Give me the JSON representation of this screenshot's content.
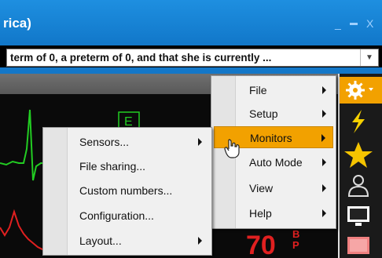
{
  "window": {
    "title": "rica)",
    "min_glyph": "_",
    "max_glyph": "▬",
    "close_glyph": "X"
  },
  "prompt": {
    "text": "term of 0, a preterm of 0, and that she is currently ..."
  },
  "monitor": {
    "lead_label": "E",
    "numeric_value": "70",
    "numeric_label_1": "B",
    "numeric_label_2": "P"
  },
  "main_menu": {
    "items": [
      {
        "label": "File",
        "submenu": true
      },
      {
        "label": "Setup",
        "submenu": true
      },
      {
        "label": "Monitors",
        "submenu": true,
        "highlighted": true
      },
      {
        "label": "Auto Mode",
        "submenu": true
      },
      {
        "label": "View",
        "submenu": true
      },
      {
        "label": "Help",
        "submenu": true
      }
    ]
  },
  "monitors_submenu": {
    "items": [
      {
        "label": "Sensors...",
        "submenu": true
      },
      {
        "label": "File sharing...",
        "submenu": false
      },
      {
        "label": "Custom numbers...",
        "submenu": false
      },
      {
        "label": "Configuration...",
        "submenu": false
      },
      {
        "label": "Layout...",
        "submenu": true
      }
    ]
  },
  "toolbar": {
    "icons": [
      "gear-icon",
      "lightning-icon",
      "star-icon",
      "person-icon",
      "monitor-icon",
      "display-icon"
    ]
  },
  "colors": {
    "title_bar": "#1a88da",
    "menu_highlight": "#f2a100",
    "ecg": "#22cc22",
    "red_wave": "#e02020"
  }
}
